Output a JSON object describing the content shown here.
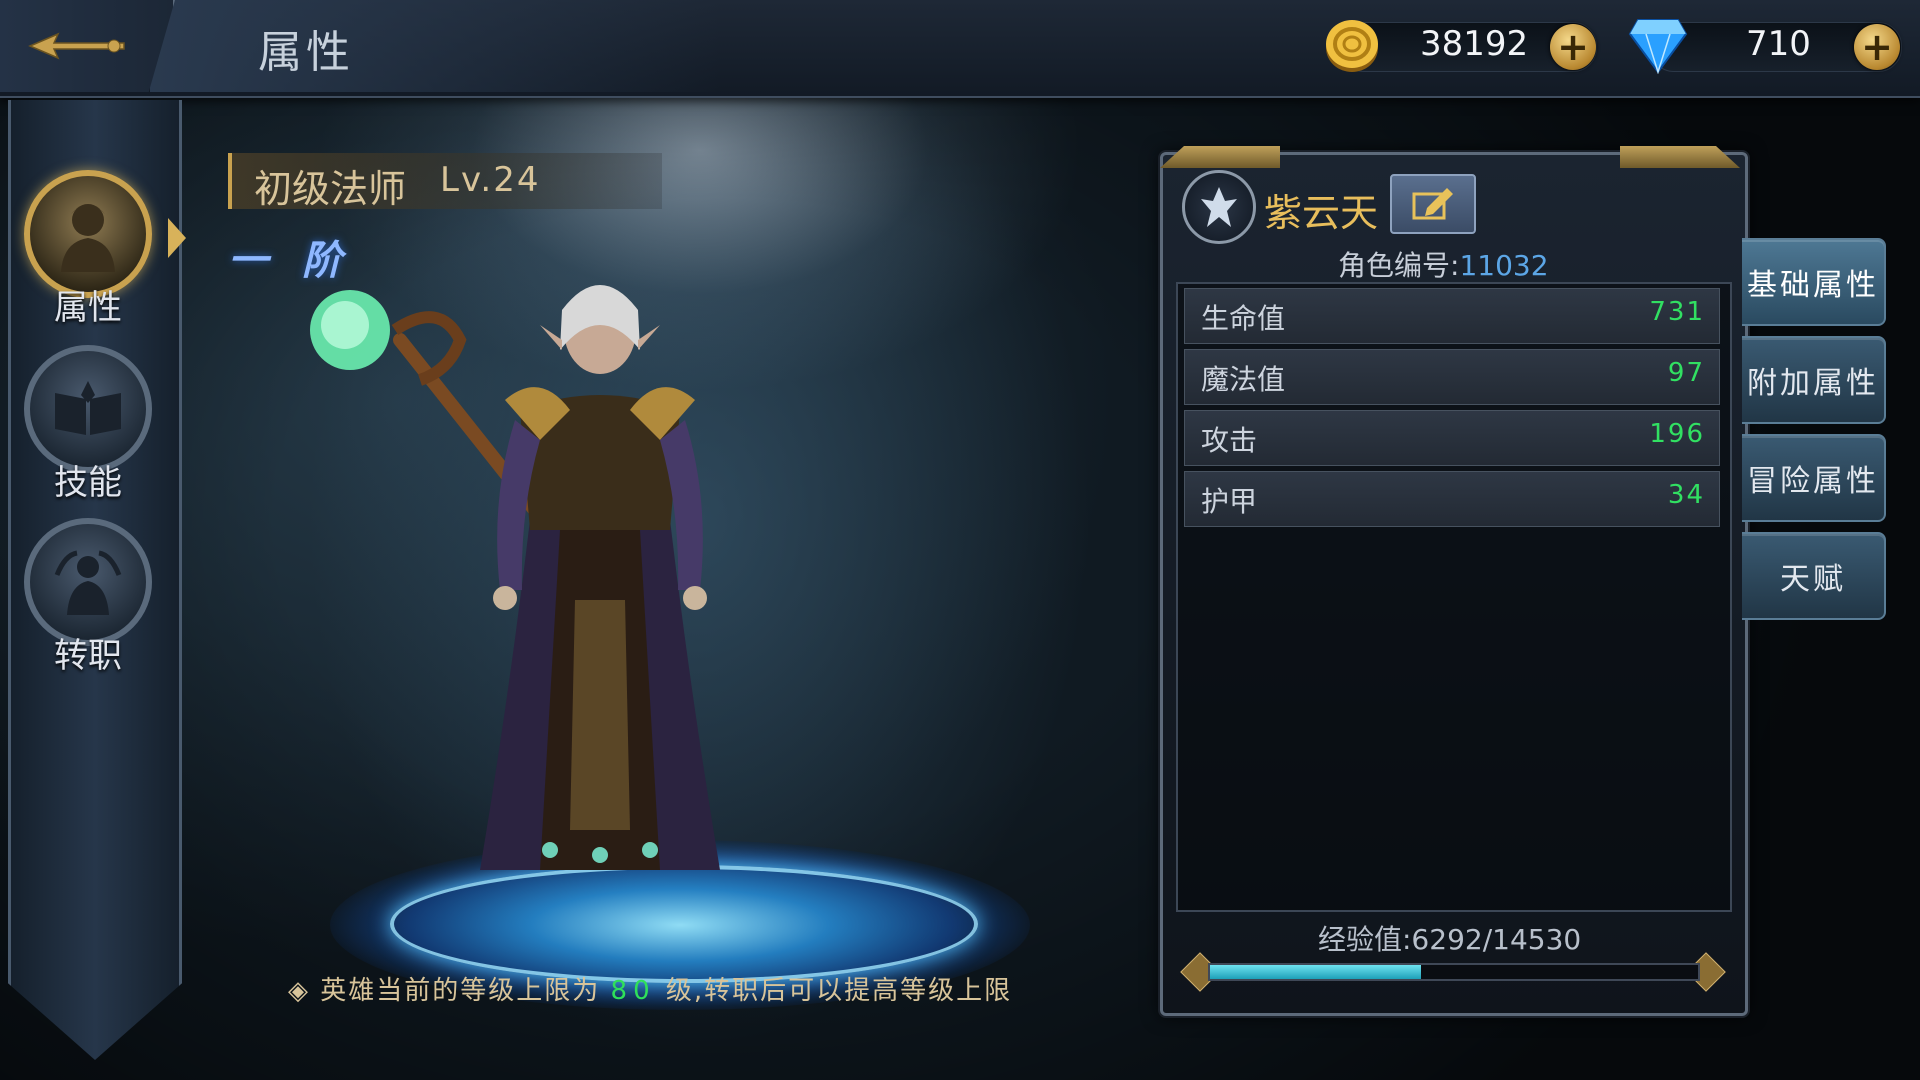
{
  "header": {
    "title": "属性"
  },
  "currency": {
    "gold": {
      "icon": "gold-coin-icon",
      "value": "38192"
    },
    "diamond": {
      "icon": "diamond-icon",
      "value": "710"
    }
  },
  "nav": {
    "items": [
      {
        "label": "属性",
        "icon": "hero-portrait-icon",
        "active": true
      },
      {
        "label": "技能",
        "icon": "spellbook-icon",
        "active": false
      },
      {
        "label": "转职",
        "icon": "class-change-icon",
        "active": false
      }
    ]
  },
  "character": {
    "class_name": "初级法师",
    "level": "Lv.24",
    "rank": "一 阶",
    "cap_note_before": "英雄当前的等级上限为",
    "cap_level": "80",
    "cap_note_after": "级,转职后可以提高等级上限"
  },
  "panel": {
    "name": "紫云天",
    "role_id_label": "角色编号:",
    "role_id": "11032",
    "stats": [
      {
        "label": "生命值",
        "value": "731"
      },
      {
        "label": "魔法值",
        "value": "97"
      },
      {
        "label": "攻击",
        "value": "196"
      },
      {
        "label": "护甲",
        "value": "34"
      }
    ],
    "exp_text": "经验值:6292/14530",
    "exp_progress": 0.433
  },
  "tabs": [
    {
      "label": "基础属性",
      "active": true
    },
    {
      "label": "附加属性",
      "active": false
    },
    {
      "label": "冒险属性",
      "active": false
    },
    {
      "label": "天赋",
      "active": false
    }
  ],
  "colors": {
    "gold_text": "#e8be5c",
    "stat_green": "#31e062",
    "accent_blue": "#5ca6e6"
  }
}
